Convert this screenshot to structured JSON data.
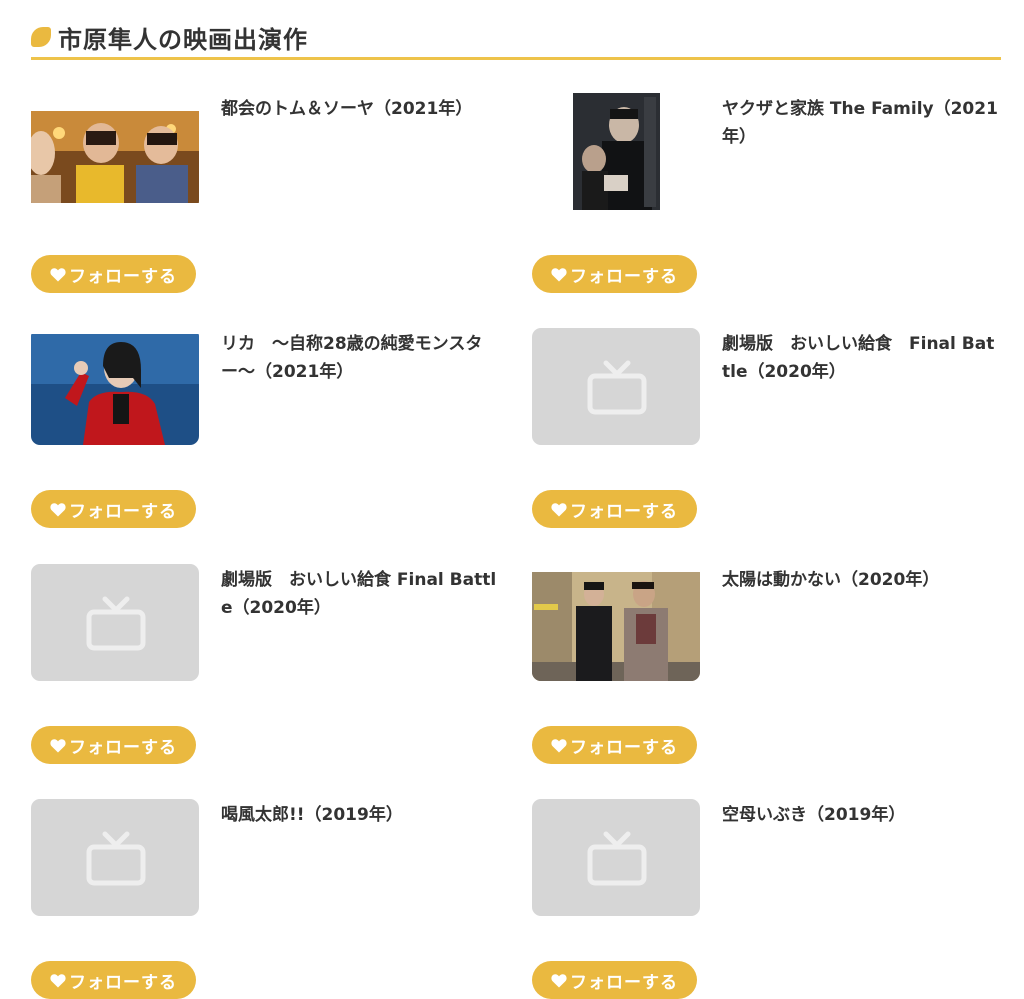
{
  "section": {
    "title": "市原隼人の映画出演作"
  },
  "follow_label": "フォローする",
  "colors": {
    "accent": "#eab940",
    "placeholder": "#d6d6d6",
    "text": "#333333"
  },
  "movies": [
    {
      "title": "都会のトム＆ソーヤ（2021年）",
      "thumbnail": "photo"
    },
    {
      "title": "ヤクザと家族 The Family（2021年）",
      "thumbnail": "poster"
    },
    {
      "title": "リカ　〜自称28歳の純愛モンスター〜（2021年）",
      "thumbnail": "photo"
    },
    {
      "title": "劇場版　おいしい給食　Final Battle（2020年）",
      "thumbnail": "tv-icon"
    },
    {
      "title": "劇場版　おいしい給食 Final Battle（2020年）",
      "thumbnail": "tv-icon"
    },
    {
      "title": "太陽は動かない（2020年）",
      "thumbnail": "photo"
    },
    {
      "title": "喝風太郎!!（2019年）",
      "thumbnail": "tv-icon"
    },
    {
      "title": "空母いぶき（2019年）",
      "thumbnail": "tv-icon"
    }
  ]
}
